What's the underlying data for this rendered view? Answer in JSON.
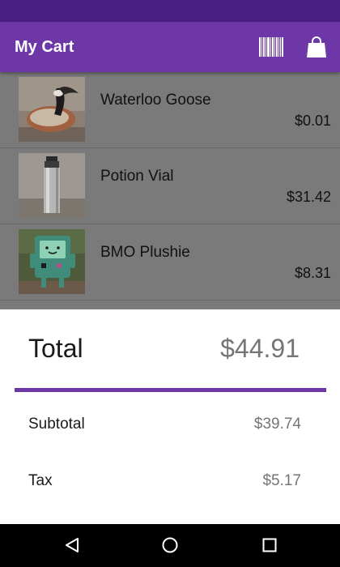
{
  "app_bar": {
    "title": "My Cart",
    "actions": [
      {
        "icon": "barcode-icon"
      },
      {
        "icon": "shopping-bag-icon"
      }
    ]
  },
  "cart": {
    "items": [
      {
        "name": "Waterloo Goose",
        "price": "$0.01",
        "image": "goose-plush-photo"
      },
      {
        "name": "Potion Vial",
        "price": "$31.42",
        "image": "metal-bottle-photo"
      },
      {
        "name": "BMO Plushie",
        "price": "$8.31",
        "image": "bmo-plush-photo"
      }
    ]
  },
  "summary": {
    "total_label": "Total",
    "total_value": "$44.91",
    "subtotal_label": "Subtotal",
    "subtotal_value": "$39.74",
    "tax_label": "Tax",
    "tax_value": "$5.17"
  },
  "nav": {
    "buttons": [
      {
        "icon": "back-icon"
      },
      {
        "icon": "home-icon"
      },
      {
        "icon": "recents-icon"
      }
    ]
  },
  "colors": {
    "status_bar": "#4a1f83",
    "app_bar": "#6d37a8",
    "accent": "#6d37a8",
    "list_overlay": "#7a7a7a"
  }
}
